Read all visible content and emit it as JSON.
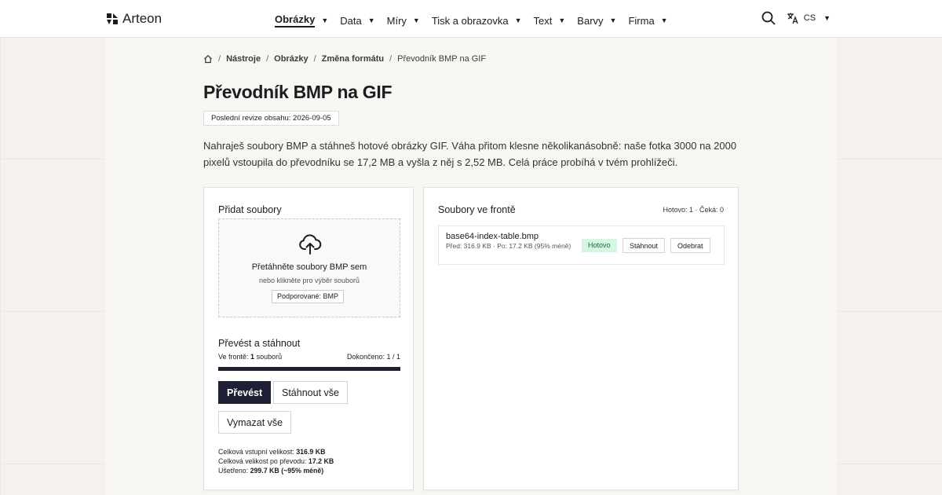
{
  "brand": {
    "name": "Arteon"
  },
  "nav": {
    "items": [
      {
        "label": "Obrázky",
        "active": true
      },
      {
        "label": "Data"
      },
      {
        "label": "Míry"
      },
      {
        "label": "Tisk a obrazovka"
      },
      {
        "label": "Text"
      },
      {
        "label": "Barvy"
      },
      {
        "label": "Firma"
      }
    ],
    "lang": "CS"
  },
  "breadcrumb": [
    "Nástroje",
    "Obrázky",
    "Změna formátu",
    "Převodník BMP na GIF"
  ],
  "page": {
    "title": "Převodník BMP na GIF",
    "revision": "Poslední revize obsahu: 2026-09-05",
    "intro": "Nahraješ soubory BMP a stáhneš hotové obrázky GIF. Váha přitom klesne několikanásobně: naše fotka 3000 na 2000 pixelů vstoupila do převodníku se 17,2 MB a vyšla z něj s 2,52 MB. Celá práce probíhá v tvém prohlížeči."
  },
  "upload": {
    "title": "Přidat soubory",
    "drop_text": "Přetáhněte soubory BMP sem",
    "drop_sub": "nebo klikněte pro výběr souborů",
    "supported": "Podporované: BMP"
  },
  "convert": {
    "title": "Převést a stáhnout",
    "queue_label": "Ve frontě:",
    "queue_count": "1",
    "queue_unit": "souborů",
    "done_label": "Dokončeno: 1 / 1",
    "progress": 1.0,
    "btn_convert": "Převést",
    "btn_download_all": "Stáhnout vše",
    "btn_clear_all": "Vymazat vše"
  },
  "totals": {
    "input_label": "Celková vstupní velikost:",
    "input_value": "316.9 KB",
    "output_label": "Celková velikost po převodu:",
    "output_value": "17.2 KB",
    "saved_label": "Ušetřeno:",
    "saved_value": "299.7 KB (~95% méně)"
  },
  "queue": {
    "title": "Soubory ve frontě",
    "counts": "Hotovo: 1 · Čeká: 0",
    "files": [
      {
        "name": "base64-index-table.bmp",
        "meta": "Před: 316.9 KB · Po: 17.2 KB (95% méně)",
        "status": "Hotovo",
        "download": "Stáhnout",
        "remove": "Odebrat"
      }
    ]
  },
  "colors": {
    "accent": "#1f2033",
    "status_done_bg": "#d6f5e3",
    "status_done_text": "#1d6a3f"
  }
}
